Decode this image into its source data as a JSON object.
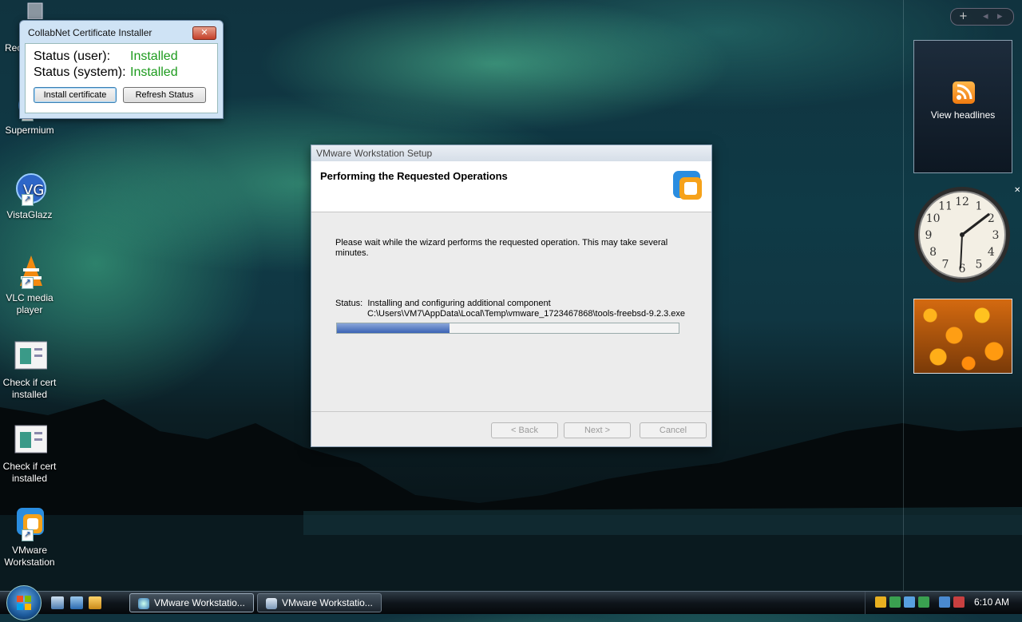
{
  "desktop": {
    "icons": [
      {
        "label": "Rec",
        "icon": "recycle-bin-icon"
      },
      {
        "label": "Supermium",
        "icon": "supermium-icon"
      },
      {
        "label": "VistaGlazz",
        "icon": "vistaglazz-icon"
      },
      {
        "label": "VLC media player",
        "icon": "vlc-cone-icon"
      },
      {
        "label": "Check if cert installed",
        "icon": "document-icon"
      },
      {
        "label": "Check if cert installed",
        "icon": "document-icon"
      },
      {
        "label": "VMware Workstation",
        "icon": "vmware-icon"
      }
    ]
  },
  "collabnet": {
    "title": "CollabNet Certificate Installer",
    "close_glyph": "✕",
    "user_label": "Status (user):",
    "user_value": "Installed",
    "system_label": "Status (system):",
    "system_value": "Installed",
    "install_button": "Install certificate",
    "refresh_button": "Refresh Status",
    "status_color": "#1c9a1c"
  },
  "vmware_setup": {
    "title": "VMware Workstation Setup",
    "heading": "Performing the Requested Operations",
    "message_line1": "Please wait while the wizard performs the requested operation. This may take several",
    "message_line2": "minutes.",
    "status_line": "Status:  Installing and configuring additional component",
    "path_line": "C:\\Users\\VM7\\AppData\\Local\\Temp\\vmware_1723467868\\tools-freebsd-9.2.3.exe",
    "progress_fraction": 0.33,
    "back_button": "< Back",
    "next_button": "Next >",
    "cancel_button": "Cancel"
  },
  "sidebar": {
    "add_glyph": "+",
    "prev_glyph": "◂",
    "next_glyph": "▸",
    "feed_label": "View headlines",
    "clock_numbers": [
      "12",
      "1",
      "2",
      "3",
      "4",
      "5",
      "6",
      "7",
      "8",
      "9",
      "10",
      "11"
    ],
    "close_glyph": "✕"
  },
  "taskbar": {
    "tasks": [
      {
        "label": "VMware Workstatio...",
        "icon": "supermium-browser-icon"
      },
      {
        "label": "VMware Workstatio...",
        "icon": "vmware-setup-icon"
      }
    ],
    "clock": "6:10 AM"
  }
}
